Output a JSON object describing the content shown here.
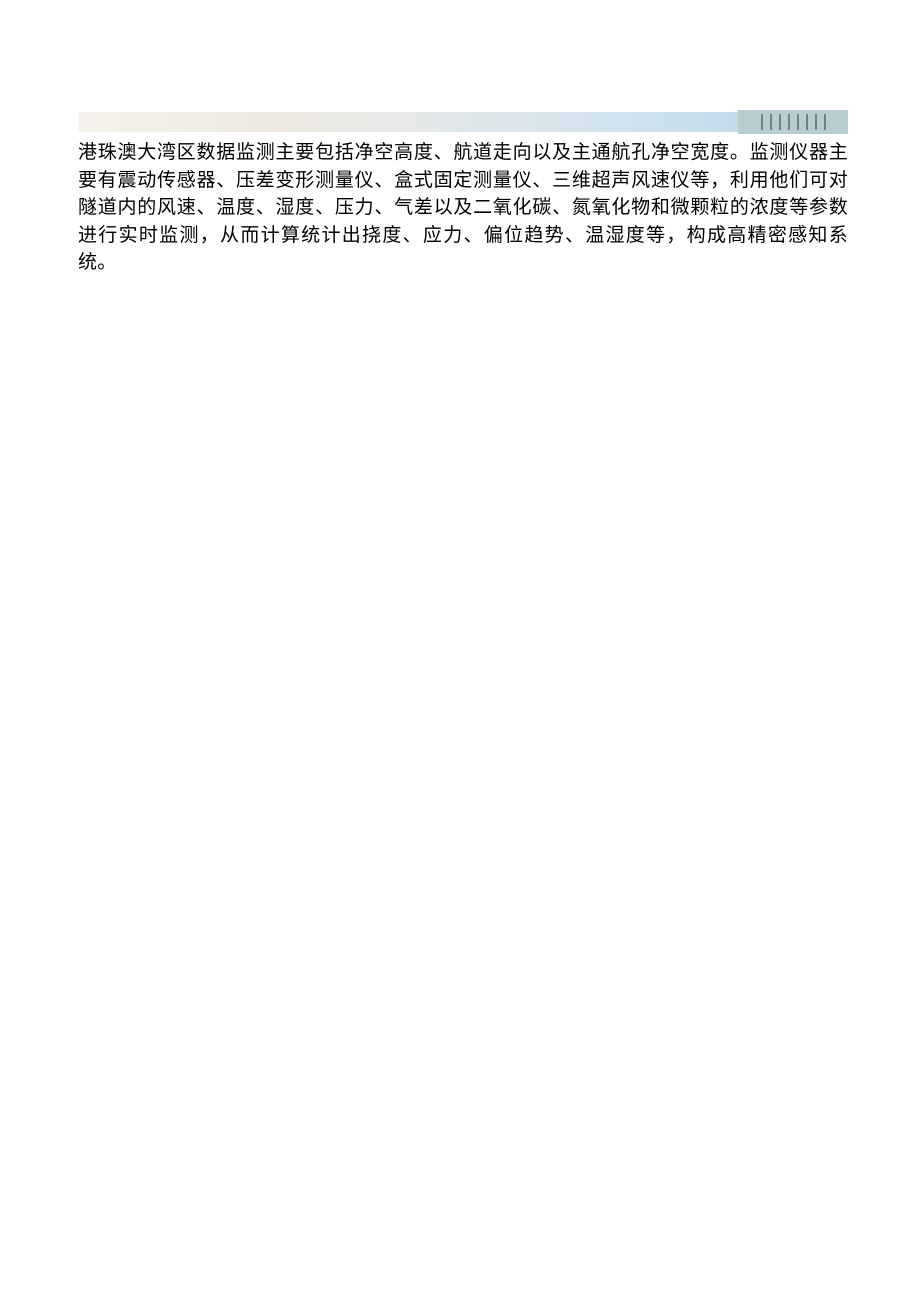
{
  "document": {
    "paragraph": "港珠澳大湾区数据监测主要包括净空高度、航道走向以及主通航孔净空宽度。监测仪器主要有震动传感器、压差变形测量仪、盒式固定测量仪、三维超声风速仪等，利用他们可对隧道内的风速、温度、湿度、压力、气差以及二氧化碳、氮氧化物和微颗粒的浓度等参数进行实时监测，从而计算统计出挠度、应力、偏位趋势、温湿度等，构成高精密感知系统。"
  }
}
